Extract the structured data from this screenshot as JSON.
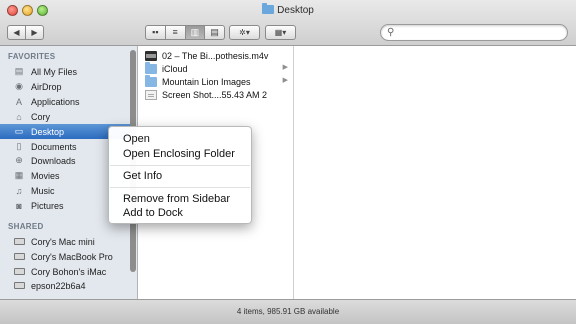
{
  "window": {
    "title": "Desktop"
  },
  "toolbar": {
    "back_glyph": "◀",
    "forward_glyph": "▶",
    "view_icons": [
      "▪▪",
      "≡",
      "▥",
      "▤"
    ],
    "action_glyph": "✲▾",
    "arrange_glyph": "▦▾",
    "search_placeholder": "",
    "search_glyph": "⚲"
  },
  "sidebar": {
    "favorites_heading": "FAVORITES",
    "favorites": [
      {
        "label": "All My Files",
        "icon": "all-files-icon",
        "glyph": "▤"
      },
      {
        "label": "AirDrop",
        "icon": "airdrop-icon",
        "glyph": "◉"
      },
      {
        "label": "Applications",
        "icon": "applications-icon",
        "glyph": "A"
      },
      {
        "label": "Cory",
        "icon": "home-icon",
        "glyph": "⌂"
      },
      {
        "label": "Desktop",
        "icon": "desktop-icon",
        "glyph": "▭"
      },
      {
        "label": "Documents",
        "icon": "documents-icon",
        "glyph": "▯"
      },
      {
        "label": "Downloads",
        "icon": "downloads-icon",
        "glyph": "⊕"
      },
      {
        "label": "Movies",
        "icon": "movies-icon",
        "glyph": "▦"
      },
      {
        "label": "Music",
        "icon": "music-icon",
        "glyph": "♫"
      },
      {
        "label": "Pictures",
        "icon": "pictures-icon",
        "glyph": "◙"
      }
    ],
    "shared_heading": "SHARED",
    "shared": [
      {
        "label": "Cory's Mac mini",
        "icon": "mac-mini-icon"
      },
      {
        "label": "Cory's MacBook Pro",
        "icon": "macbook-pro-icon"
      },
      {
        "label": "Cory Bohon's iMac",
        "icon": "imac-icon"
      },
      {
        "label": "epson22b6a4",
        "icon": "printer-icon"
      }
    ],
    "selected": "Desktop"
  },
  "files": [
    {
      "name": "02 – The Bi...pothesis.m4v",
      "type": "movie",
      "has_children": false
    },
    {
      "name": "iCloud",
      "type": "folder",
      "has_children": true
    },
    {
      "name": "Mountain Lion Images",
      "type": "folder",
      "has_children": true
    },
    {
      "name": "Screen Shot....55.43 AM 2",
      "type": "doc",
      "has_children": false
    }
  ],
  "file_arrow_glyph": "▶",
  "context_menu": {
    "group1": [
      "Open",
      "Open Enclosing Folder"
    ],
    "group2": [
      "Get Info"
    ],
    "group3": [
      "Remove from Sidebar",
      "Add to Dock"
    ]
  },
  "status": {
    "text": "4 items, 985.91 GB available"
  },
  "colors": {
    "selection": "#2c6cc0",
    "sidebar_bg": "#e3e8ee",
    "folder": "#86b6e4"
  }
}
